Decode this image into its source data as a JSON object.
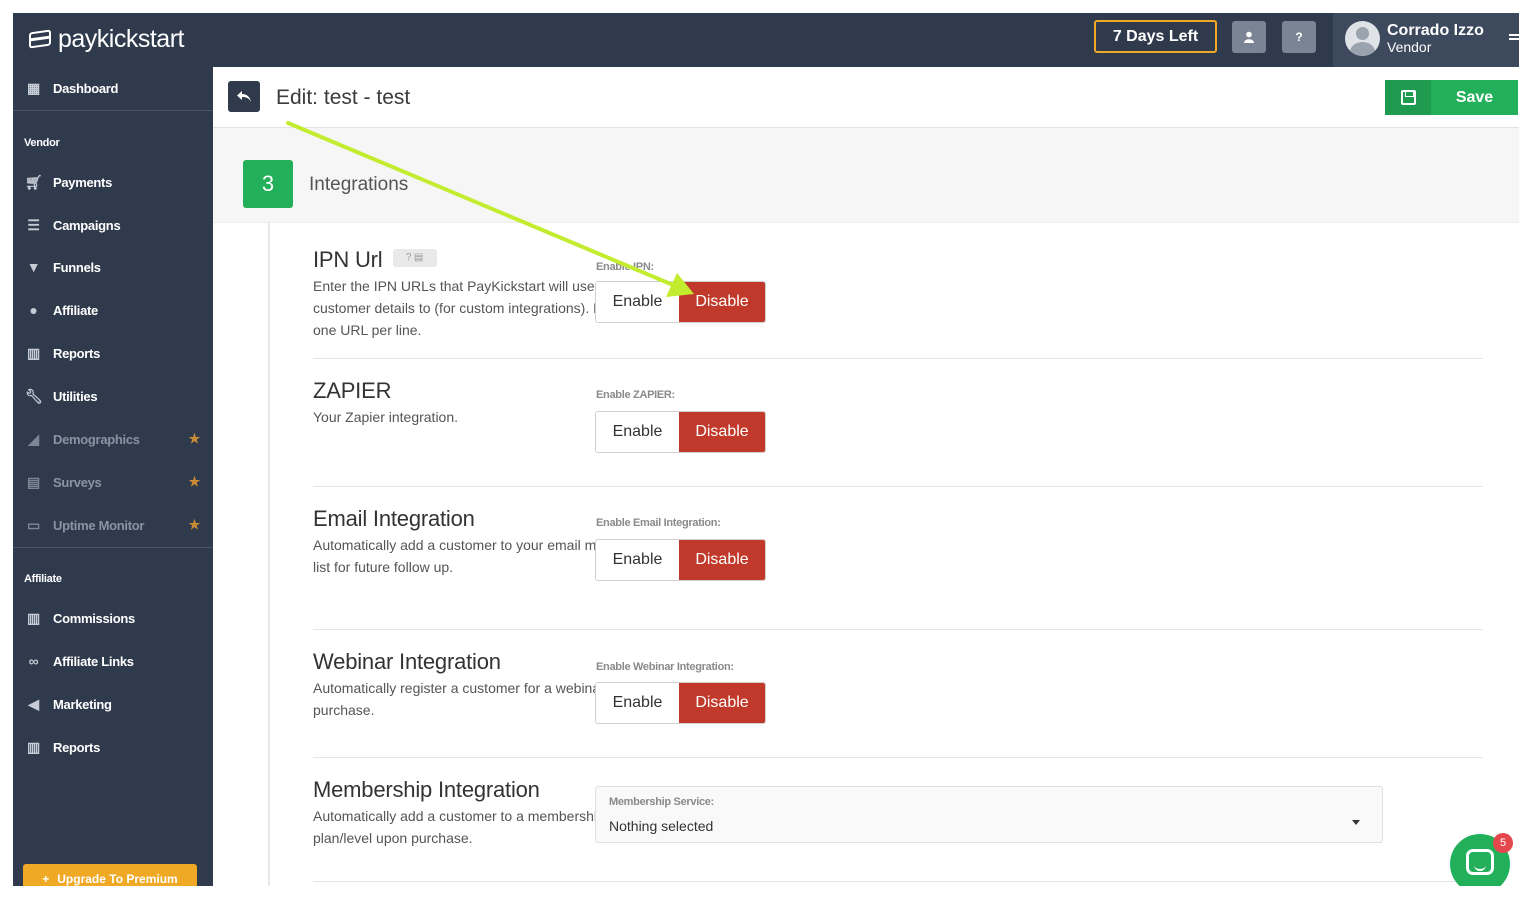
{
  "app": {
    "logo_text": "paykickstart",
    "days_left": "7 Days Left",
    "help_label": "?",
    "user": {
      "name": "Corrado Izzo",
      "role": "Vendor"
    }
  },
  "sidebar": {
    "top_items": [
      {
        "label": "Dashboard",
        "icon": "dashboard-icon"
      }
    ],
    "vendor_section": "Vendor",
    "vendor_items": [
      {
        "label": "Payments",
        "icon": "cart-icon"
      },
      {
        "label": "Campaigns",
        "icon": "list-icon"
      },
      {
        "label": "Funnels",
        "icon": "filter-icon"
      },
      {
        "label": "Affiliate",
        "icon": "user-icon"
      },
      {
        "label": "Reports",
        "icon": "bar-chart-icon"
      },
      {
        "label": "Utilities",
        "icon": "wrench-icon"
      },
      {
        "label": "Demographics",
        "icon": "area-chart-icon",
        "premium": true
      },
      {
        "label": "Surveys",
        "icon": "document-icon",
        "premium": true
      },
      {
        "label": "Uptime Monitor",
        "icon": "monitor-icon",
        "premium": true
      }
    ],
    "affiliate_section": "Affiliate",
    "affiliate_items": [
      {
        "label": "Commissions",
        "icon": "bar-chart-icon"
      },
      {
        "label": "Affiliate Links",
        "icon": "link-icon"
      },
      {
        "label": "Marketing",
        "icon": "megaphone-icon"
      },
      {
        "label": "Reports",
        "icon": "bar-chart-icon"
      }
    ],
    "upgrade_label": "Upgrade To Premium"
  },
  "header": {
    "title": "Edit: test - test",
    "save_label": "Save"
  },
  "section": {
    "step": "3",
    "title": "Integrations"
  },
  "integrations": [
    {
      "title": "IPN Url",
      "description": "Enter the IPN URLs that PayKickstart will use to send customer details to (for custom integrations). Enter one URL per line.",
      "toggle_label": "Enable IPN:",
      "enable_label": "Enable",
      "disable_label": "Disable",
      "state": "Disable"
    },
    {
      "title": "ZAPIER",
      "description": "Your Zapier integration.",
      "toggle_label": "Enable ZAPIER:",
      "enable_label": "Enable",
      "disable_label": "Disable",
      "state": "Disable"
    },
    {
      "title": "Email Integration",
      "description": "Automatically add a customer to your email marketing list for future follow up.",
      "toggle_label": "Enable Email Integration:",
      "enable_label": "Enable",
      "disable_label": "Disable",
      "state": "Disable"
    },
    {
      "title": "Webinar Integration",
      "description": "Automatically register a customer for a webinar upon purchase.",
      "toggle_label": "Enable Webinar Integration:",
      "enable_label": "Enable",
      "disable_label": "Disable",
      "state": "Disable"
    },
    {
      "title": "Membership Integration",
      "description": "Automatically add a customer to a membership plan/level upon purchase.",
      "select_label": "Membership Service:",
      "select_value": "Nothing selected"
    }
  ],
  "chat": {
    "unread_count": "5"
  },
  "colors": {
    "navy": "#2f3a4c",
    "accent_green": "#22b05a",
    "disable_red": "#c0392b",
    "warning_orange": "#f0a925",
    "annotation_arrow": "#c3ec2f"
  }
}
